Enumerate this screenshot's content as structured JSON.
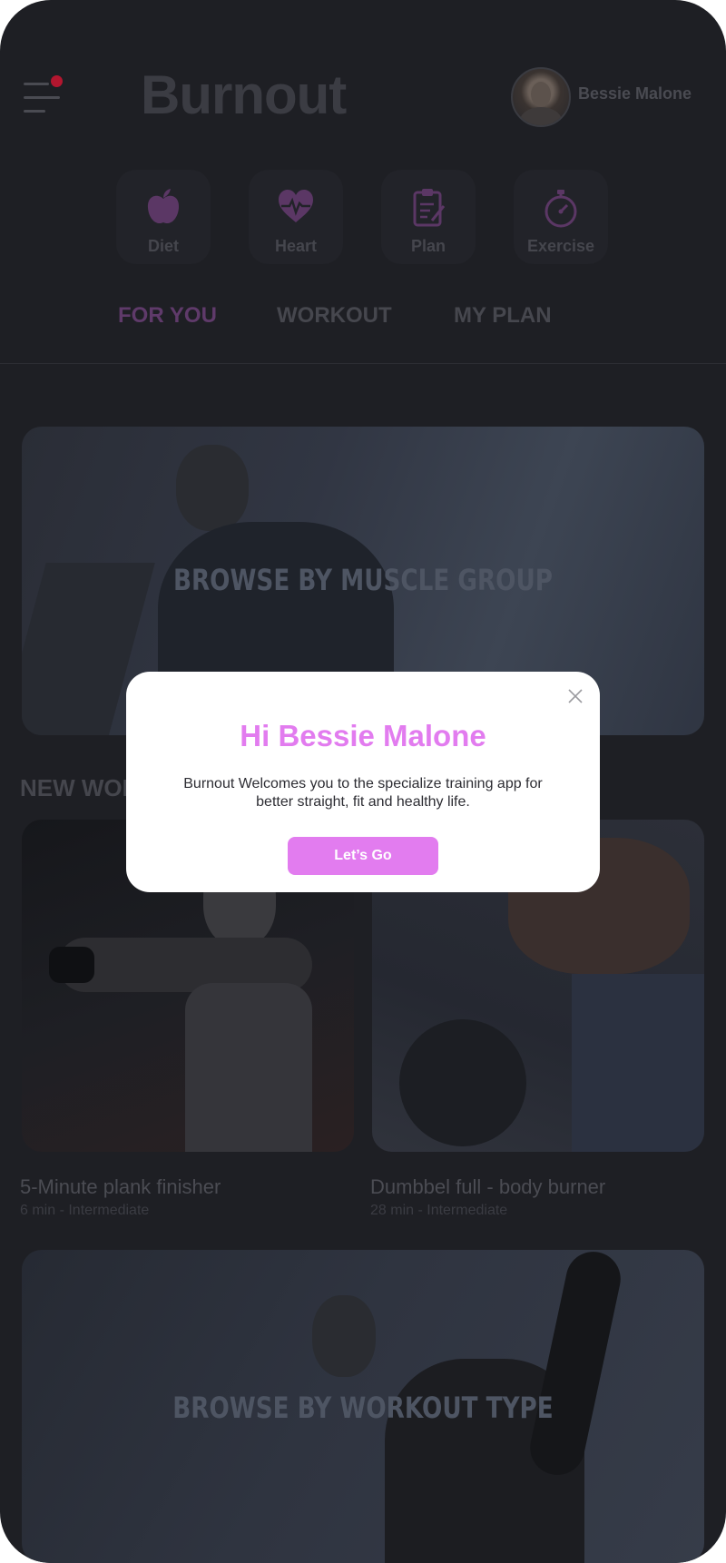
{
  "app": {
    "title": "Burnout",
    "user_name": "Bessie Malone",
    "notification_color": "#b3162f"
  },
  "categories": [
    {
      "label": "Diet",
      "icon": "apple-icon"
    },
    {
      "label": "Heart",
      "icon": "heart-pulse-icon"
    },
    {
      "label": "Plan",
      "icon": "clipboard-icon"
    },
    {
      "label": "Exercise",
      "icon": "stopwatch-icon"
    }
  ],
  "tabs": [
    {
      "label": "FOR YOU",
      "active": true
    },
    {
      "label": "WORKOUT",
      "active": false
    },
    {
      "label": "MY PLAN",
      "active": false
    }
  ],
  "banners": {
    "muscle_group": "BROWSE BY MUSCLE  GROUP",
    "workout_type": "BROWSE BY WORKOUT TYPE"
  },
  "section": {
    "new_workouts": "NEW WORKOUTS"
  },
  "workouts": [
    {
      "title": "5-Minute plank finisher",
      "meta": "6 min - Intermediate"
    },
    {
      "title": "Dumbbel full - body  burner",
      "meta": "28 min - Intermediate"
    }
  ],
  "modal": {
    "title": "Hi Bessie Malone",
    "body": "Burnout Welcomes you to the specialize training app for better straight, fit and healthy life.",
    "button": "Let’s Go",
    "accent": "#e27cef"
  }
}
